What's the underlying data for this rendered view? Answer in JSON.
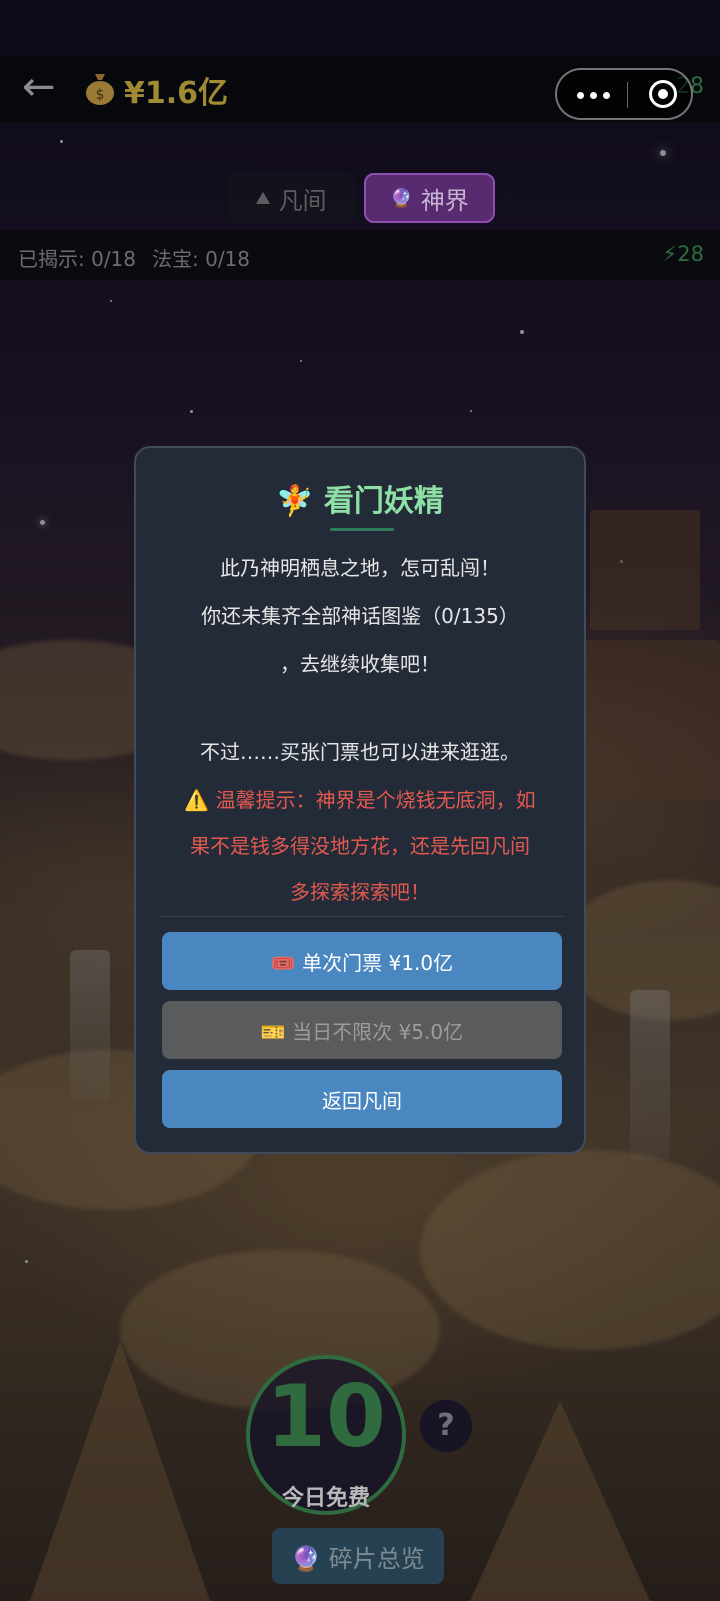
{
  "header": {
    "back_glyph": "←",
    "money_icon": "money-bag-icon",
    "money": "¥1.6亿",
    "hidden_number": "28"
  },
  "tabs": [
    {
      "label": "凡间",
      "icon": "mountain-icon"
    },
    {
      "label": "神界",
      "icon": "crystal-ball-icon",
      "active": true
    }
  ],
  "status": {
    "revealed": "已揭示: 0/18",
    "treasure": "法宝: 0/18",
    "energy": "⚡28"
  },
  "modal": {
    "title": "🧚 看门妖精",
    "lines": [
      "此乃神明栖息之地，怎可乱闯！",
      "你还未集齐全部神话图鉴（0/135）",
      "，去继续收集吧！",
      "不过……买张门票也可以进来逛逛。"
    ],
    "warning_lines": [
      "⚠️ 温馨提示：神界是个烧钱无底洞，如",
      "果不是钱多得没地方花，还是先回凡间",
      "多探索探索吧！"
    ],
    "buttons": {
      "single": "🎟️ 单次门票 ¥1.0亿",
      "daily": "🎫 当日不限次 ¥5.0亿",
      "return": "返回凡间"
    }
  },
  "bottom": {
    "free_count": "10",
    "free_label": "今日免费",
    "help": "?",
    "overview": "🔮 碎片总览"
  },
  "colors": {
    "accent_blue": "#4a86bf",
    "title_green": "#8fe0a5",
    "warning_red": "#e25a4f",
    "tab_active_purple": "#8e4fb3"
  }
}
